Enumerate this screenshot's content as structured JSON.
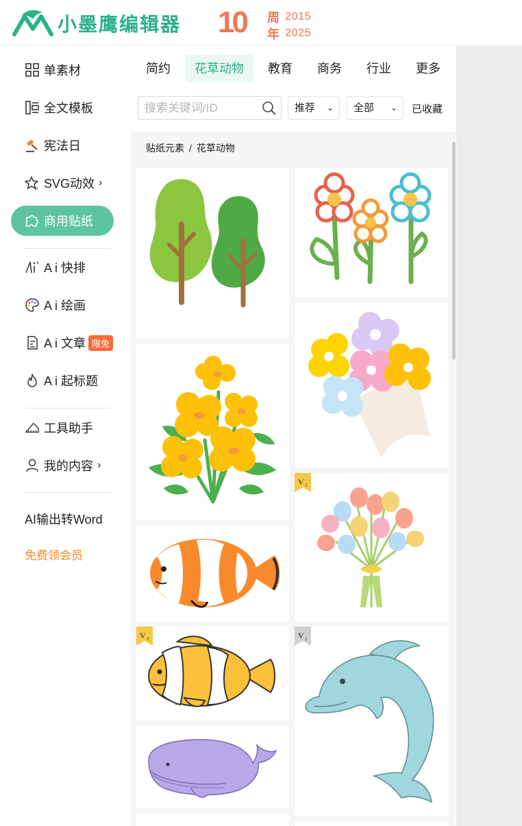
{
  "header": {
    "logo_text": "小墨鹰编辑器",
    "anniversary": {
      "number": "10",
      "zhou": "周",
      "nian": "年",
      "year_start": "2015",
      "year_end": "2025"
    }
  },
  "sidebar": {
    "items": [
      {
        "label": "单素材",
        "icon": "grid-icon"
      },
      {
        "label": "全文模板",
        "icon": "layout-icon"
      },
      {
        "label": "宪法日",
        "icon": "gavel-icon"
      },
      {
        "label": "SVG动效",
        "icon": "star-svg-icon",
        "chevron": "›"
      },
      {
        "label": "商用贴纸",
        "icon": "puzzle-icon"
      },
      {
        "label": "A i 快排",
        "icon": "ai-layout-icon"
      },
      {
        "label": "A i 绘画",
        "icon": "palette-icon"
      },
      {
        "label": "A i 文章",
        "icon": "document-icon",
        "badge": "限免"
      },
      {
        "label": "A i 起标题",
        "icon": "flame-icon"
      },
      {
        "label": "工具助手",
        "icon": "ruler-icon"
      },
      {
        "label": "我的内容",
        "icon": "user-icon",
        "chevron": "›"
      }
    ],
    "ai_word": "AI输出转Word",
    "free_vip": "免费领会员"
  },
  "tabs": [
    "简约",
    "花草动物",
    "教育",
    "商务",
    "行业",
    "更多"
  ],
  "active_tab": "花草动物",
  "search": {
    "placeholder": "搜索关键词/ID",
    "value": ""
  },
  "filters": {
    "sort": "推荐",
    "range": "全部",
    "collected": "已收藏"
  },
  "breadcrumb": {
    "root": "贴纸元素",
    "separator": "/",
    "current": "花草动物"
  },
  "stickers": [
    {
      "name": "trees-sticker"
    },
    {
      "name": "flowers-sticker"
    },
    {
      "name": "yellow-flowers-sticker"
    },
    {
      "name": "bouquet-sticker"
    },
    {
      "name": "clownfish-orange-sticker"
    },
    {
      "name": "tulip-bouquet-sticker",
      "badge": "V2"
    },
    {
      "name": "clownfish-yellow-sticker",
      "badge": "V2"
    },
    {
      "name": "dolphin-sticker",
      "badge": "V1"
    },
    {
      "name": "whale-sticker"
    }
  ],
  "colors": {
    "brand": "#2bb08a",
    "active_side": "#5cc4a0",
    "anniversary": "#f0785a",
    "promo": "#f08a24",
    "badge": "#f86a3a"
  }
}
